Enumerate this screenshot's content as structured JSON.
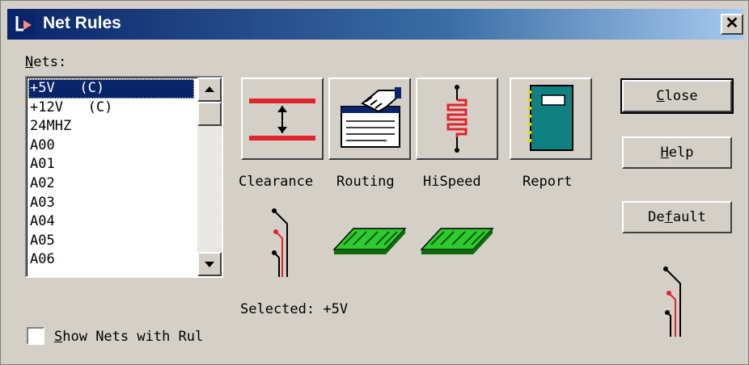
{
  "window": {
    "title": "Net Rules",
    "close_symbol": "✕"
  },
  "nets": {
    "label_underlined": "N",
    "label_rest": "ets:",
    "items": [
      "+5V   (C)",
      "+12V   (C)",
      "24MHZ",
      "A00",
      "A01",
      "A02",
      "A03",
      "A04",
      "A05",
      "A06"
    ],
    "selected_index": 0
  },
  "tools": [
    {
      "label": "Clearance",
      "icon": "clearance-icon"
    },
    {
      "label": "Routing",
      "icon": "routing-icon"
    },
    {
      "label": "HiSpeed",
      "icon": "hispeed-icon"
    },
    {
      "label": "Report",
      "icon": "report-icon"
    }
  ],
  "selected_text": "Selected: +5V",
  "show_nets": {
    "underlined": "S",
    "rest": "how Nets with Rul",
    "checked": false
  },
  "buttons": {
    "close": {
      "pre": "",
      "u": "C",
      "post": "lose"
    },
    "help": {
      "pre": "",
      "u": "H",
      "post": "elp"
    },
    "default": {
      "pre": "De",
      "u": "f",
      "post": "ault"
    }
  },
  "colors": {
    "title_bar": "#0a246a",
    "face": "#d4d0c8",
    "selection": "#0a246a",
    "trace_red": "#e0242c",
    "board_green": "#2ecb2e",
    "report_teal": "#108080"
  }
}
